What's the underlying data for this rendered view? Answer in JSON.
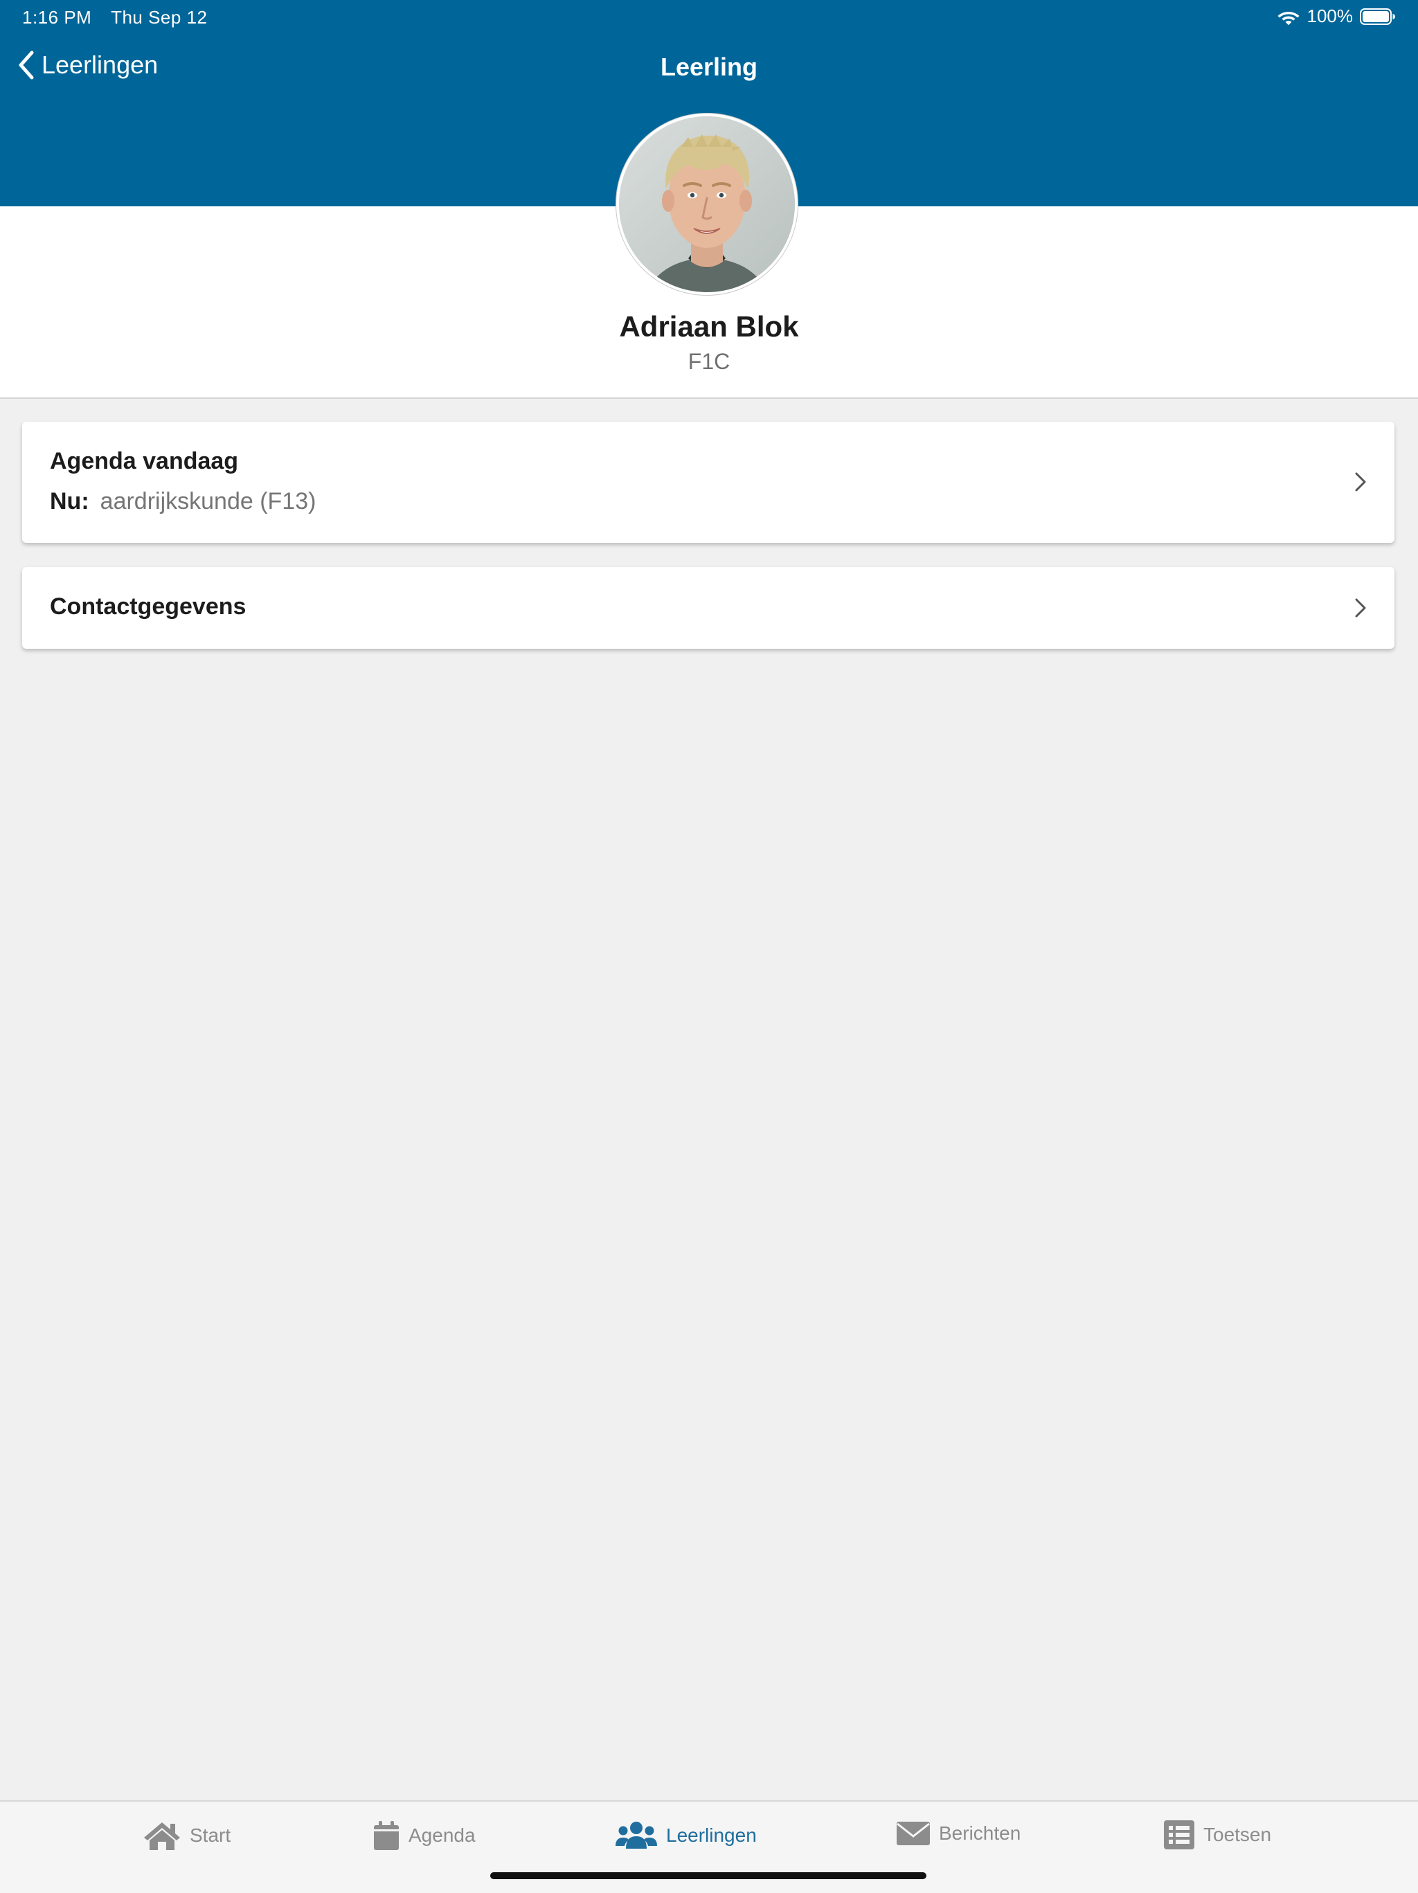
{
  "status_bar": {
    "time": "1:16 PM",
    "date": "Thu Sep 12",
    "battery": "100%",
    "wifi_icon": "wifi-icon",
    "battery_icon": "battery-full-icon"
  },
  "nav": {
    "back_label": "Leerlingen",
    "title": "Leerling"
  },
  "student": {
    "name": "Adriaan Blok",
    "class": "F1C"
  },
  "cards": {
    "agenda": {
      "title": "Agenda vandaag",
      "now_label": "Nu:",
      "now_value": "aardrijkskunde (F13)"
    },
    "contact": {
      "title": "Contactgegevens"
    }
  },
  "tabs": [
    {
      "label": "Start",
      "icon": "home-icon",
      "active": false
    },
    {
      "label": "Agenda",
      "icon": "calendar-icon",
      "active": false
    },
    {
      "label": "Leerlingen",
      "icon": "users-icon",
      "active": true
    },
    {
      "label": "Berichten",
      "icon": "envelope-icon",
      "active": false
    },
    {
      "label": "Toetsen",
      "icon": "list-icon",
      "active": false
    }
  ],
  "colors": {
    "header_blue": "#006699",
    "active_tab": "#1f6e9e",
    "inactive_tab": "#8c8c8c",
    "background": "#f0f0f0"
  }
}
